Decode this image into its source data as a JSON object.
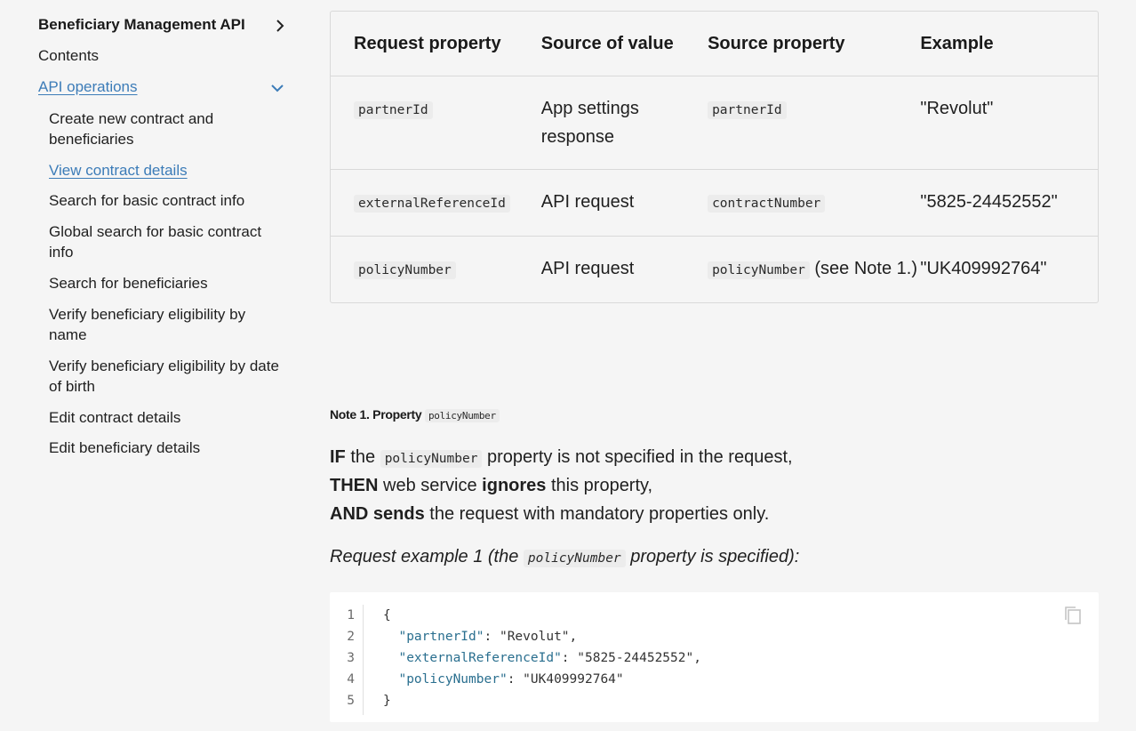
{
  "sidebar": {
    "title": "Beneficiary Management API",
    "contents": "Contents",
    "api_operations": "API operations",
    "items": [
      {
        "label": "Create new contract and beneficiaries"
      },
      {
        "label": "View contract details"
      },
      {
        "label": "Search for basic contract info"
      },
      {
        "label": "Global search for basic contract info"
      },
      {
        "label": "Search for beneficiaries"
      },
      {
        "label": "Verify beneficiary eligibility by name"
      },
      {
        "label": "Verify beneficiary eligibility by date of birth"
      },
      {
        "label": "Edit contract details"
      },
      {
        "label": "Edit beneficiary details"
      }
    ]
  },
  "table": {
    "headers": [
      "Request property",
      "Source of value",
      "Source property",
      "Example"
    ],
    "rows": [
      {
        "request_property": "partnerId",
        "source_of_value": "App settings response",
        "source_property": "partnerId",
        "source_suffix": "",
        "example": "\"Revolut\""
      },
      {
        "request_property": "externalReferenceId",
        "source_of_value": "API request",
        "source_property": "contractNumber",
        "source_suffix": "",
        "example": "\"5825-24452552\""
      },
      {
        "request_property": "policyNumber",
        "source_of_value": "API request",
        "source_property": "policyNumber",
        "source_suffix": " (see Note 1.)",
        "example": "\"UK409992764\""
      }
    ]
  },
  "note": {
    "title_prefix": "Note 1. Property",
    "title_code": "policyNumber",
    "if_kw": "IF",
    "if_text1": " the ",
    "if_code": "policyNumber",
    "if_text2": " property is not specified in the request,",
    "then_kw": "THEN",
    "then_text1": " web service ",
    "then_kw2": "ignores",
    "then_text2": " this property,",
    "and_kw": "AND sends",
    "and_text": " the request with mandatory properties only."
  },
  "example": {
    "prefix": "Request example 1 (the ",
    "code": "policyNumber",
    "suffix": " property is specified):"
  },
  "code_block": {
    "line_numbers": [
      "1",
      "2",
      "3",
      "4",
      "5"
    ],
    "open": "{",
    "close": "}",
    "entries": [
      {
        "key": "\"partnerId\"",
        "value": "\"Revolut\"",
        "trail": ","
      },
      {
        "key": "\"externalReferenceId\"",
        "value": "\"5825-24452552\"",
        "trail": ","
      },
      {
        "key": "\"policyNumber\"",
        "value": "\"UK409992764\"",
        "trail": ""
      }
    ]
  },
  "colors": {
    "link": "#3c7cb8",
    "background": "#f5f5f5",
    "code_key": "#2a6f8f"
  },
  "icons": {
    "title_chevron": "chevron-right-icon",
    "api_chevron": "chevron-down-icon",
    "copy": "copy-icon"
  }
}
